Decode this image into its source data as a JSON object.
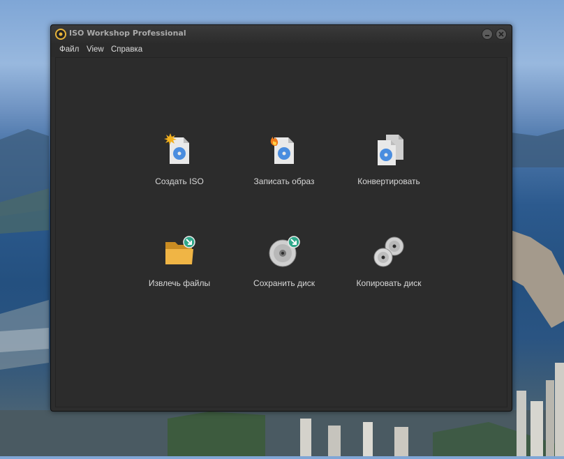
{
  "window": {
    "title": "ISO Workshop Professional"
  },
  "menu": [
    "Файл",
    "View",
    "Справка"
  ],
  "actions": [
    {
      "label": "Создать ISO",
      "icon": "create-iso-icon"
    },
    {
      "label": "Записать образ",
      "icon": "burn-image-icon"
    },
    {
      "label": "Конвертировать",
      "icon": "convert-icon"
    },
    {
      "label": "Извлечь файлы",
      "icon": "extract-folder-icon"
    },
    {
      "label": "Сохранить диск",
      "icon": "save-disc-icon"
    },
    {
      "label": "Копировать диск",
      "icon": "copy-disc-icon"
    }
  ],
  "colors": {
    "window_bg": "#2d2d2d",
    "text": "#d8d8d8",
    "disc_blue": "#4a8ddf",
    "badge_green": "#2fa88a",
    "folder": "#e3a93a"
  }
}
